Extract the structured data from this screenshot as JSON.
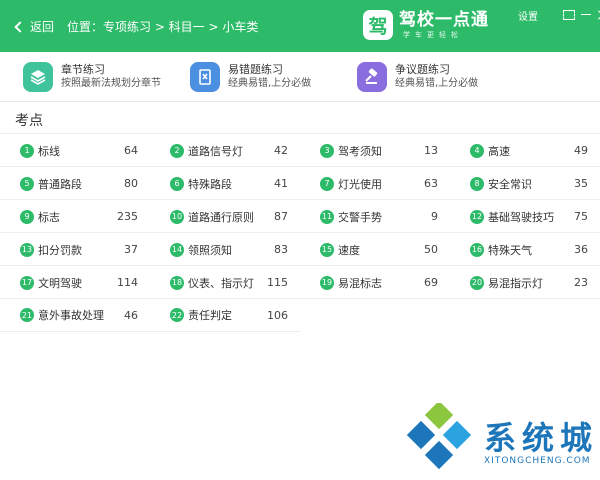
{
  "header": {
    "back_label": "返回",
    "breadcrumb": "位置：专项练习 > 科目一 > 小车类",
    "brand_logo_char": "驾",
    "brand_name": "驾校一点通",
    "brand_slogan": "学车更轻松",
    "settings_label": "设置",
    "accent_color": "#2dbb6a"
  },
  "modes": [
    {
      "title": "章节练习",
      "subtitle": "按照最新法规划分章节",
      "icon": "layers-icon",
      "color": "#3ec39a"
    },
    {
      "title": "易错题练习",
      "subtitle": "经典易错,上分必做",
      "icon": "book-icon",
      "color": "#4a8fe0"
    },
    {
      "title": "争议题练习",
      "subtitle": "经典易错,上分必做",
      "icon": "gavel-icon",
      "color": "#8a6ee0"
    }
  ],
  "section": {
    "title": "考点"
  },
  "topics": [
    {
      "no": "1",
      "name": "标线",
      "count": "64"
    },
    {
      "no": "2",
      "name": "道路信号灯",
      "count": "42"
    },
    {
      "no": "3",
      "name": "驾考须知",
      "count": "13"
    },
    {
      "no": "4",
      "name": "高速",
      "count": "49"
    },
    {
      "no": "5",
      "name": "普通路段",
      "count": "80"
    },
    {
      "no": "6",
      "name": "特殊路段",
      "count": "41"
    },
    {
      "no": "7",
      "name": "灯光使用",
      "count": "63"
    },
    {
      "no": "8",
      "name": "安全常识",
      "count": "35"
    },
    {
      "no": "9",
      "name": "标志",
      "count": "235"
    },
    {
      "no": "10",
      "name": "道路通行原则",
      "count": "87"
    },
    {
      "no": "11",
      "name": "交警手势",
      "count": "9"
    },
    {
      "no": "12",
      "name": "基础驾驶技巧",
      "count": "75"
    },
    {
      "no": "13",
      "name": "扣分罚款",
      "count": "37"
    },
    {
      "no": "14",
      "name": "领照须知",
      "count": "83"
    },
    {
      "no": "15",
      "name": "速度",
      "count": "50"
    },
    {
      "no": "16",
      "name": "特殊天气",
      "count": "36"
    },
    {
      "no": "17",
      "name": "文明驾驶",
      "count": "114"
    },
    {
      "no": "18",
      "name": "仪表、指示灯",
      "count": "115"
    },
    {
      "no": "19",
      "name": "易混标志",
      "count": "69"
    },
    {
      "no": "20",
      "name": "易混指示灯",
      "count": "23"
    },
    {
      "no": "21",
      "name": "意外事故处理",
      "count": "46"
    },
    {
      "no": "22",
      "name": "责任判定",
      "count": "106"
    }
  ],
  "watermark": {
    "text": "系统城",
    "url": "XITONGCHENG.COM"
  }
}
